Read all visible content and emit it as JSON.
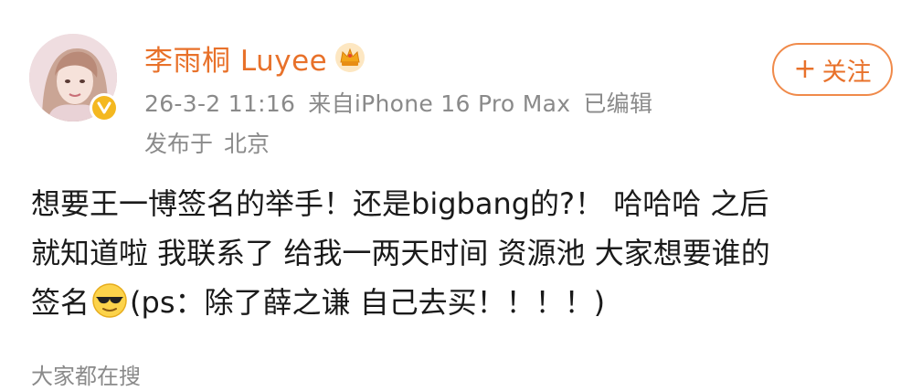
{
  "user": {
    "name": "李雨桐 Luyee",
    "badge_icon": "crown-icon",
    "verified_icon": "verified-v-icon",
    "name_color": "#e8712a"
  },
  "meta": {
    "timestamp": "26-3-2 11:16",
    "source": "来自iPhone 16 Pro Max",
    "edited": "已编辑"
  },
  "location": {
    "prefix": "发布于",
    "city": "北京"
  },
  "follow_button": {
    "plus": "+",
    "label": "关注"
  },
  "post": {
    "line1": "想要王一博签名的举手！还是bigbang的?！ 哈哈哈 之后",
    "line2": "就知道啦 我联系了 给我一两天时间 资源池 大家想要谁的",
    "line3_before_emoji": "签名",
    "emoji_icon": "sunglasses-emoji-icon",
    "line3_after_emoji": "(ps：除了薛之谦 自己去买！！！！)"
  },
  "footer": {
    "trending": "大家都在搜"
  }
}
